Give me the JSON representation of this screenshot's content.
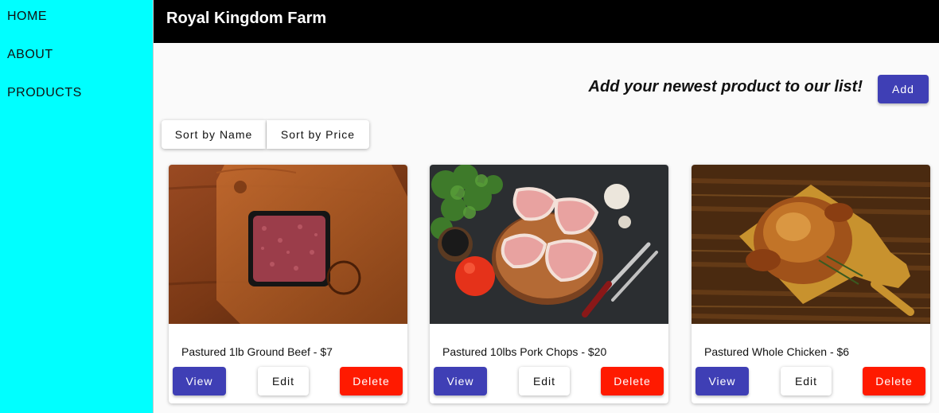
{
  "sidebar": {
    "items": [
      {
        "label": "HOME"
      },
      {
        "label": "ABOUT"
      },
      {
        "label": "PRODUCTS"
      }
    ]
  },
  "header": {
    "title": "Royal Kingdom Farm"
  },
  "add_section": {
    "prompt": "Add your newest product to our list!",
    "button_label": "Add"
  },
  "sort": {
    "by_name_label": "Sort by Name",
    "by_price_label": "Sort by Price"
  },
  "products": [
    {
      "title": "Pastured 1lb Ground Beef - $7",
      "image": "ground-beef-photo",
      "view_label": "View",
      "edit_label": "Edit",
      "delete_label": "Delete"
    },
    {
      "title": "Pastured 10lbs Pork Chops - $20",
      "image": "pork-chops-photo",
      "view_label": "View",
      "edit_label": "Edit",
      "delete_label": "Delete"
    },
    {
      "title": "Pastured Whole Chicken - $6",
      "image": "roast-chicken-photo",
      "view_label": "View",
      "edit_label": "Edit",
      "delete_label": "Delete"
    }
  ],
  "colors": {
    "sidebar_bg": "#00ffff",
    "header_bg": "#000000",
    "primary": "#3f3fb5",
    "danger": "#ff1a00"
  }
}
